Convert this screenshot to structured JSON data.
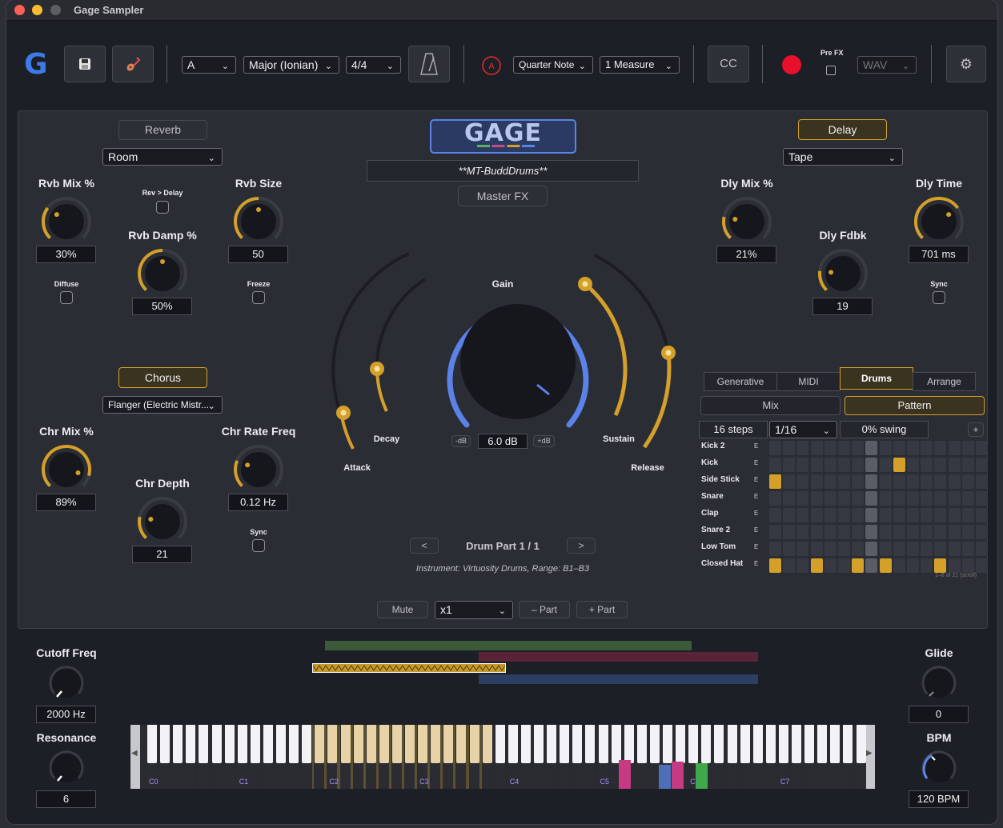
{
  "window": {
    "title": "Gage Sampler"
  },
  "toolbar": {
    "logo": "G",
    "key": "A",
    "scale": "Major (Ionian)",
    "time_sig": "4/4",
    "note_value": "Quarter Note",
    "length": "1 Measure",
    "cc": "CC",
    "pre_fx": "Pre FX",
    "format": "WAV"
  },
  "reverb": {
    "title": "Reverb",
    "type": "Room",
    "mix_label": "Rvb Mix %",
    "mix_value": "30%",
    "mix": 0.3,
    "size_label": "Rvb Size",
    "size_value": "50",
    "size": 0.5,
    "damp_label": "Rvb Damp %",
    "damp_value": "50%",
    "damp": 0.5,
    "rev_delay": "Rev > Delay",
    "diffuse": "Diffuse",
    "freeze": "Freeze"
  },
  "chorus": {
    "title": "Chorus",
    "type": "Flanger (Electric Mistr...",
    "mix_label": "Chr Mix %",
    "mix_value": "89%",
    "mix": 0.89,
    "depth_label": "Chr Depth",
    "depth_value": "21",
    "depth": 0.21,
    "rate_label": "Chr Rate Freq",
    "rate_value": "0.12 Hz",
    "rate": 0.25,
    "sync": "Sync"
  },
  "center": {
    "logo": "GAGE",
    "preset": "**MT-BuddDrums**",
    "master_fx": "Master FX",
    "gain_label": "Gain",
    "gain_value": "6.0 dB",
    "minus_db": "-dB",
    "plus_db": "+dB",
    "attack": "Attack",
    "decay": "Decay",
    "sustain": "Sustain",
    "release": "Release",
    "part_label": "Drum Part 1 / 1",
    "prev": "<",
    "next": ">",
    "instrument": "Instrument: Virtuosity Drums, Range: B1–B3",
    "mute": "Mute",
    "mult": "x1",
    "minus_part": "– Part",
    "plus_part": "+ Part"
  },
  "delay": {
    "title": "Delay",
    "type": "Tape",
    "mix_label": "Dly Mix %",
    "mix_value": "21%",
    "mix": 0.21,
    "time_label": "Dly Time",
    "time_value": "701 ms",
    "time": 0.7,
    "fdbk_label": "Dly Fdbk",
    "fdbk_value": "19",
    "fdbk": 0.19,
    "sync": "Sync"
  },
  "seq": {
    "tabs": [
      "Generative",
      "MIDI",
      "Drums",
      "Arrange"
    ],
    "subtabs": [
      "Mix",
      "Pattern"
    ],
    "steps": "16 steps",
    "rate": "1/16",
    "swing": "0% swing",
    "add": "+",
    "rows": [
      "Kick 2",
      "Kick",
      "Side Stick",
      "Snare",
      "Clap",
      "Snare 2",
      "Low Tom",
      "Closed Hat"
    ],
    "edit": "E",
    "active": [
      [],
      [
        9
      ],
      [
        0
      ],
      [],
      [],
      [],
      [],
      [
        0,
        3,
        6,
        8,
        12
      ]
    ],
    "playhead": 7,
    "footer": "1–8 of 21 (scroll)"
  },
  "bottom": {
    "cutoff_label": "Cutoff Freq",
    "cutoff_value": "2000 Hz",
    "res_label": "Resonance",
    "res_value": "6",
    "glide_label": "Glide",
    "glide_value": "0",
    "bpm_label": "BPM",
    "bpm_value": "120 BPM",
    "octaves": [
      "C0",
      "C1",
      "C2",
      "C3",
      "C4",
      "C5",
      "C6",
      "C7"
    ]
  },
  "colors": {
    "accent": "#d4a02a",
    "blue": "#5b82e8",
    "record": "#e8102a"
  }
}
